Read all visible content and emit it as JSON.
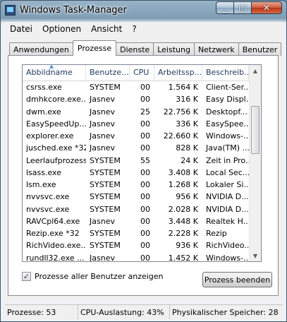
{
  "window": {
    "title": "Windows Task-Manager",
    "minimize": "_",
    "maximize": "□",
    "close": "✕"
  },
  "menu": [
    "Datei",
    "Optionen",
    "Ansicht",
    "?"
  ],
  "tabs": [
    "Anwendungen",
    "Prozesse",
    "Dienste",
    "Leistung",
    "Netzwerk",
    "Benutzer"
  ],
  "active_tab": "Prozesse",
  "columns": [
    "Abbildname",
    "Benutze...",
    "CPU",
    "Arbeitssp...",
    "Beschreib..."
  ],
  "sort_indicator": "▲",
  "processes": [
    [
      "csrss.exe",
      "SYSTEM",
      "00",
      "1.564 K",
      "Client-Ser..."
    ],
    [
      "dmhkcore.exe...",
      "Jasnev",
      "00",
      "316 K",
      "Easy Displ..."
    ],
    [
      "dwm.exe",
      "Jasnev",
      "25",
      "22.756 K",
      "Desktopf..."
    ],
    [
      "EasySpeedUp...",
      "Jasnev",
      "00",
      "336 K",
      "EasySpee..."
    ],
    [
      "explorer.exe",
      "Jasnev",
      "00",
      "22.660 K",
      "Windows-..."
    ],
    [
      "jusched.exe *32",
      "Jasnev",
      "00",
      "828 K",
      "Java(TM) ..."
    ],
    [
      "Leerlaufprozess",
      "SYSTEM",
      "55",
      "24 K",
      "Zeit in Pro..."
    ],
    [
      "lsass.exe",
      "SYSTEM",
      "00",
      "3.408 K",
      "Local Sec..."
    ],
    [
      "lsm.exe",
      "SYSTEM",
      "00",
      "1.268 K",
      "Lokaler Si..."
    ],
    [
      "nvvsvc.exe",
      "SYSTEM",
      "00",
      "956 K",
      "NVIDIA D..."
    ],
    [
      "nvvsvc.exe",
      "SYSTEM",
      "00",
      "2.028 K",
      "NVIDIA D..."
    ],
    [
      "RAVCpl64.exe",
      "Jasnev",
      "00",
      "3.448 K",
      "Realtek H..."
    ],
    [
      "Rezip.exe *32",
      "SYSTEM",
      "00",
      "2.228 K",
      "Rezip"
    ],
    [
      "RichVideo.exe...",
      "SYSTEM",
      "00",
      "936 K",
      "RichVideo..."
    ],
    [
      "rundll32.exe ...",
      "Jasnev",
      "00",
      "1.452 K",
      "Windows-..."
    ]
  ],
  "scroll": {
    "up": "▲",
    "down": "▼"
  },
  "show_all_users": {
    "checked": true,
    "mark": "✓",
    "label": "Prozesse aller Benutzer anzeigen"
  },
  "end_process_button": "Prozess beenden",
  "status": {
    "processes": "Prozesse: 53",
    "cpu": "CPU-Auslastung: 43%",
    "memory": "Physikalischer Speicher: 28"
  }
}
